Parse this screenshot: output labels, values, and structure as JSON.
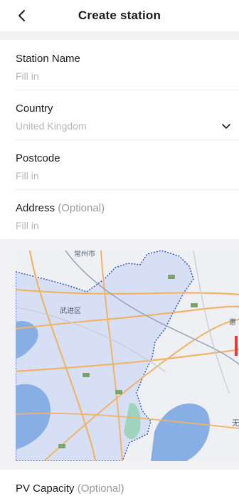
{
  "header": {
    "title": "Create station",
    "back_icon": "chevron-left-icon"
  },
  "fields": {
    "station_name": {
      "label": "Station Name",
      "placeholder": "Fill in"
    },
    "country": {
      "label": "Country",
      "value": "United Kingdom",
      "icon": "chevron-down-icon"
    },
    "postcode": {
      "label": "Postcode",
      "placeholder": "Fill in"
    },
    "address": {
      "label": "Address",
      "optional": "(Optional)",
      "placeholder": "Fill in"
    }
  },
  "map": {
    "district_label": "武进区",
    "top_label": "常州市",
    "right_edge_label_1": "惠",
    "right_edge_label_2": "无"
  },
  "pv_capacity": {
    "label": "PV Capacity",
    "optional": "(Optional)"
  },
  "colors": {
    "placeholder": "#b7b7b7",
    "region_border": "#2d4fc7",
    "water": "#88aee6"
  }
}
